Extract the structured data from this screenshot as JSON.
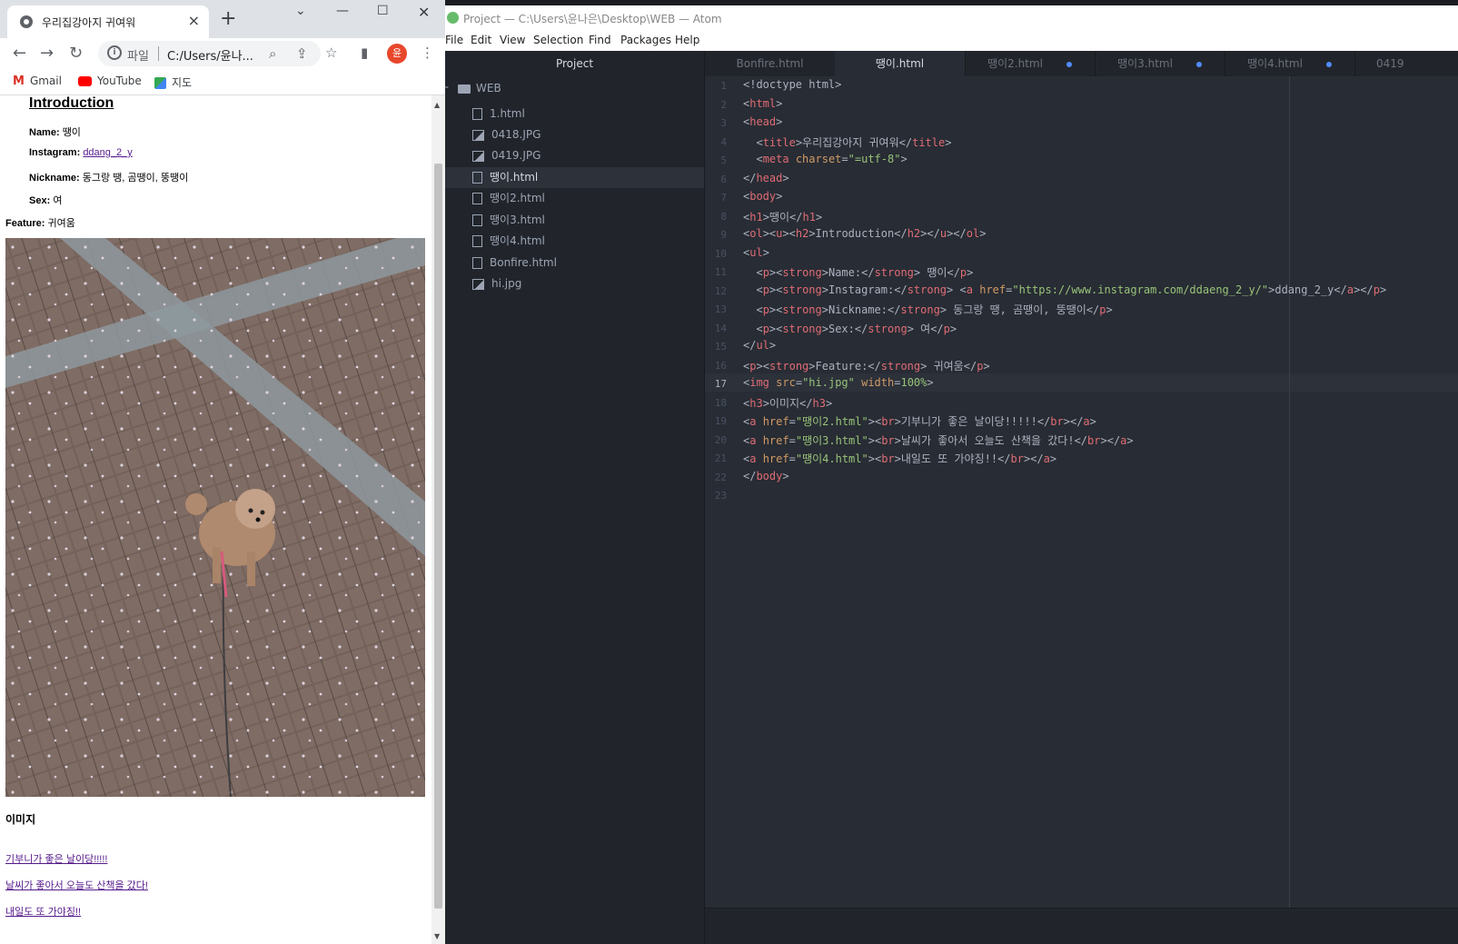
{
  "browser": {
    "tab_title": "우리집강아지 귀여워",
    "tab_close": "×",
    "new_tab": "+",
    "omnibox_scheme": "파일",
    "omnibox_url": "C:/Users/윤나...",
    "profile_initial": "윤",
    "bookmarks": [
      {
        "label": "Gmail",
        "icon": "gmail-icon"
      },
      {
        "label": "YouTube",
        "icon": "youtube-icon"
      },
      {
        "label": "지도",
        "icon": "maps-icon"
      }
    ],
    "page": {
      "heading": "Introduction",
      "name_label": "Name:",
      "name_value": "땡이",
      "instagram_label": "Instagram:",
      "instagram_link": "ddang_2_y",
      "nickname_label": "Nickname:",
      "nickname_value": "동그랑 땡, 곰땡이, 뚱땡이",
      "sex_label": "Sex:",
      "sex_value": "여",
      "feature_label": "Feature:",
      "feature_value": "귀여움",
      "image_heading": "이미지",
      "links": [
        "기부니가 좋은 날이당!!!!!",
        "날씨가 좋아서 오늘도 산책을 갔다!",
        "내일도 또 가야징!!"
      ]
    }
  },
  "atom": {
    "window_title": "Project — C:\\Users\\윤나은\\Desktop\\WEB — Atom",
    "menu": [
      "File",
      "Edit",
      "View",
      "Selection",
      "Find",
      "Packages",
      "Help"
    ],
    "tree_header": "Project",
    "root_folder": "WEB",
    "files": [
      {
        "name": "1.html",
        "kind": "file"
      },
      {
        "name": "0418.JPG",
        "kind": "image"
      },
      {
        "name": "0419.JPG",
        "kind": "image"
      },
      {
        "name": "땡이.html",
        "kind": "file",
        "selected": true
      },
      {
        "name": "땡이2.html",
        "kind": "file"
      },
      {
        "name": "땡이3.html",
        "kind": "file"
      },
      {
        "name": "땡이4.html",
        "kind": "file"
      },
      {
        "name": "Bonfire.html",
        "kind": "file"
      },
      {
        "name": "hi.jpg",
        "kind": "image"
      }
    ],
    "tabs": [
      {
        "label": "Bonfire.html",
        "modified": false
      },
      {
        "label": "땡이.html",
        "modified": false,
        "active": true
      },
      {
        "label": "땡이2.html",
        "modified": true
      },
      {
        "label": "땡이3.html",
        "modified": true
      },
      {
        "label": "땡이4.html",
        "modified": true
      },
      {
        "label": "0419",
        "modified": false
      }
    ],
    "current_line": 17,
    "line_numbers": [
      "1",
      "2",
      "3",
      "4",
      "5",
      "6",
      "7",
      "8",
      "9",
      "10",
      "11",
      "12",
      "13",
      "14",
      "15",
      "16",
      "17",
      "18",
      "19",
      "20",
      "21",
      "22",
      "23"
    ],
    "code": [
      "<!doctype html>",
      "<html>",
      "<head>",
      "  <title>우리집강아지 귀여워</title>",
      "  <meta charset=\"=utf-8\">",
      "</head>",
      "<body>",
      "<h1>땡이</h1>",
      "<ol><u><h2>Introduction</h2></u></ol>",
      "<ul>",
      "  <p><strong>Name:</strong> 땡이</p>",
      "  <p><strong>Instagram:</strong> <a href=\"https://www.instagram.com/ddaeng_2_y/\">ddang_2_y</a></p>",
      "  <p><strong>Nickname:</strong> 동그랑 땡, 곰땡이, 뚱땡이</p>",
      "  <p><strong>Sex:</strong> 여</p>",
      "</ul>",
      "<p><strong>Feature:</strong> 귀여움</p>",
      "<img src=\"hi.jpg\" width=100%>",
      "<h3>이미지</h3>",
      "<a href=\"땡이2.html\"><br>기부니가 좋은 날이당!!!!!</br></a>",
      "<a href=\"땡이3.html\"><br>날씨가 좋아서 오늘도 산책을 갔다!</br></a>",
      "<a href=\"땡이4.html\"><br>내일도 또 가야징!!</br></a>",
      "</body>",
      ""
    ]
  }
}
